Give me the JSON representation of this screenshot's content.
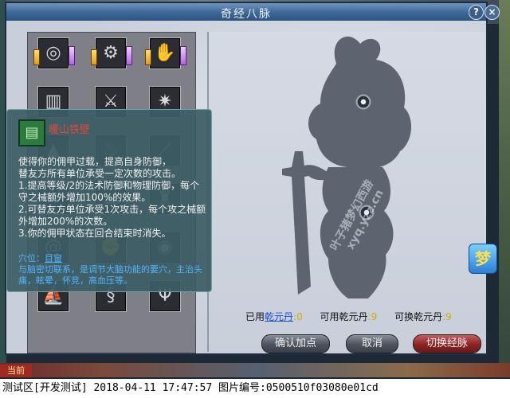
{
  "window": {
    "title": "奇经八脉",
    "help_label": "?",
    "close_label": "×"
  },
  "skills": [
    {
      "icon": "eye-icon",
      "glyph": "◎",
      "locked": true
    },
    {
      "icon": "magnifier-icon",
      "glyph": "⚙",
      "locked": true
    },
    {
      "icon": "hand-icon",
      "glyph": "✋",
      "locked": true
    },
    {
      "icon": "pillar-icon",
      "glyph": "▥",
      "locked": false
    },
    {
      "icon": "sword-icon",
      "glyph": "⚔",
      "locked": false
    },
    {
      "icon": "gear-icon",
      "glyph": "✷",
      "locked": false
    },
    {
      "icon": "mountain-icon",
      "glyph": "▲",
      "locked": false
    },
    {
      "icon": "flame-icon",
      "glyph": "♨",
      "locked": false
    },
    {
      "icon": "blade-icon",
      "glyph": "⟋",
      "locked": false
    },
    {
      "icon": "wave-icon",
      "glyph": "≋",
      "locked": false
    },
    {
      "icon": "cloud-icon",
      "glyph": "☁",
      "locked": false
    },
    {
      "icon": "tower-icon",
      "glyph": "♜",
      "locked": false
    },
    {
      "icon": "spiral-icon",
      "glyph": "@",
      "locked": false
    },
    {
      "icon": "fist-icon",
      "glyph": "✊",
      "locked": false
    },
    {
      "icon": "vortex-icon",
      "glyph": "◉",
      "locked": false
    },
    {
      "icon": "ship-icon",
      "glyph": "⛵",
      "locked": false
    },
    {
      "icon": "dragon-icon",
      "glyph": "§",
      "locked": false
    },
    {
      "icon": "trident-icon",
      "glyph": "Ψ",
      "locked": false
    }
  ],
  "tooltip": {
    "icon": "armor-icon",
    "glyph": "▤",
    "name": "暖山铁壁",
    "description": "使得你的佣甲过载，提高自身防御，\n替友方所有单位承受一定次数的攻击。\n1.提高等级/2的法术防御和物理防御，每个守之械额外增加100%的效果。\n2.可替友方单位承受1次攻击，每个攻之械额外增加200%的次数。\n3.你的佣甲状态在回合结束时消失。",
    "acupoint_label": "穴位：",
    "acupoint_name": "目窗",
    "acupoint_text": "与脑密切联系，是调节大脑功能的要穴，主治头痛，眩晕，怀竞，高血压等。"
  },
  "stats": {
    "used_label": "已用",
    "used_link": "乾元丹",
    "used_value": ":0",
    "available_label": "可用乾元丹",
    "available_value": ":9",
    "exchangeable_label": "可换乾元丹",
    "exchangeable_value": ":9"
  },
  "buttons": {
    "confirm": "确认加点",
    "cancel": "取消",
    "switch": "切换经脉"
  },
  "watermark": {
    "line1": "叶子猪梦幻西游",
    "line2": "xyq.yzz.cn"
  },
  "bottom": {
    "tab": "当前",
    "status": "测试区[开发测试] 2018-04-11 17:47:57 图片编号:0500510f03080e01cd"
  },
  "side_badge": "梦",
  "colors": {
    "titlebar": "#3d6796",
    "tooltip_bg": "#3c5c64",
    "skill_name": "#e04a3a",
    "acupoint": "#4fb6ff",
    "value_gold": "#d8a800",
    "cancel_red": "#8a2424"
  }
}
